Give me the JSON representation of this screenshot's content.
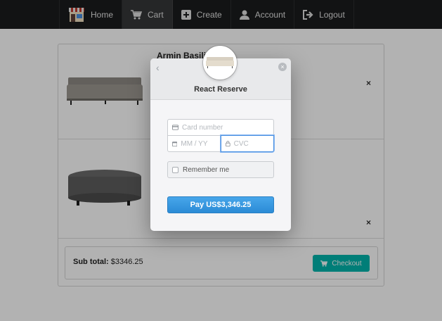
{
  "nav": {
    "items": [
      {
        "label": "Home",
        "icon": "store-icon"
      },
      {
        "label": "Cart",
        "icon": "cart-icon",
        "active": true
      },
      {
        "label": "Create",
        "icon": "plus-square-icon"
      },
      {
        "label": "Account",
        "icon": "user-icon"
      },
      {
        "label": "Logout",
        "icon": "sign-out-icon"
      }
    ]
  },
  "cart": {
    "items": [
      {
        "title": "Armin Basilio",
        "remove_label": "×",
        "image": "sofa-image"
      },
      {
        "title": "",
        "remove_label": "×",
        "image": "ottoman-image"
      }
    ],
    "subtotal_label": "Sub total:",
    "subtotal_value": "$3346.25",
    "checkout_label": "Checkout"
  },
  "modal": {
    "title": "React Reserve",
    "back_label": "‹",
    "close_label": "×",
    "card_placeholder": "Card number",
    "expiry_placeholder": "MM / YY",
    "cvc_placeholder": "CVC",
    "remember_label": "Remember me",
    "pay_label": "Pay US$3,346.25"
  },
  "colors": {
    "nav_bg": "#1b1c1d",
    "checkout": "#00b5ad",
    "pay_button": "#2b8bd6",
    "focus": "#4a90e2"
  }
}
